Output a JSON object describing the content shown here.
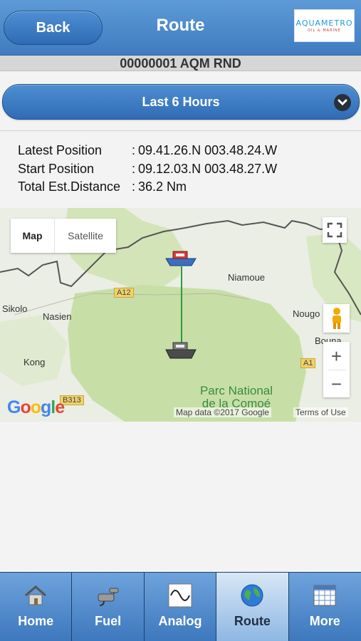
{
  "header": {
    "back_label": "Back",
    "title": "Route",
    "logo_main": "AQUAMETRO",
    "logo_sub": "OIL & MARINE"
  },
  "vessel": {
    "name": "00000001 AQM RND"
  },
  "period_select": {
    "selected": "Last 6 Hours"
  },
  "info": {
    "rows": [
      {
        "label": "Latest Position",
        "sep": ":",
        "value": "09.41.26.N 003.48.24.W"
      },
      {
        "label": "Start Position",
        "sep": ":",
        "value": "09.12.03.N 003.48.27.W"
      },
      {
        "label": "Total Est.Distance",
        "sep": ":",
        "value": "36.2 Nm"
      }
    ]
  },
  "map": {
    "type_tabs": [
      "Map",
      "Satellite"
    ],
    "places": [
      "Niamoue",
      "Sikolo",
      "Nasien",
      "Kong",
      "Nougo",
      "Bouna"
    ],
    "roads": [
      "A12",
      "A1",
      "B313"
    ],
    "park_line1": "Parc National",
    "park_line2": "de la Comoé",
    "google": "Google",
    "credit": "Map data ©2017 Google",
    "terms": "Terms of Use",
    "zoom_in": "+",
    "zoom_out": "−",
    "colors": {
      "park": "#c7dfa7",
      "land": "#eaeee4",
      "route": "#2e9a3b",
      "border": "#555555"
    }
  },
  "tabbar": {
    "items": [
      {
        "label": "Home",
        "icon": "home-icon",
        "active": false
      },
      {
        "label": "Fuel",
        "icon": "fuel-pump-icon",
        "active": false
      },
      {
        "label": "Analog",
        "icon": "sine-wave-icon",
        "active": false
      },
      {
        "label": "Route",
        "icon": "globe-icon",
        "active": true
      },
      {
        "label": "More",
        "icon": "grid-icon",
        "active": false
      }
    ]
  }
}
